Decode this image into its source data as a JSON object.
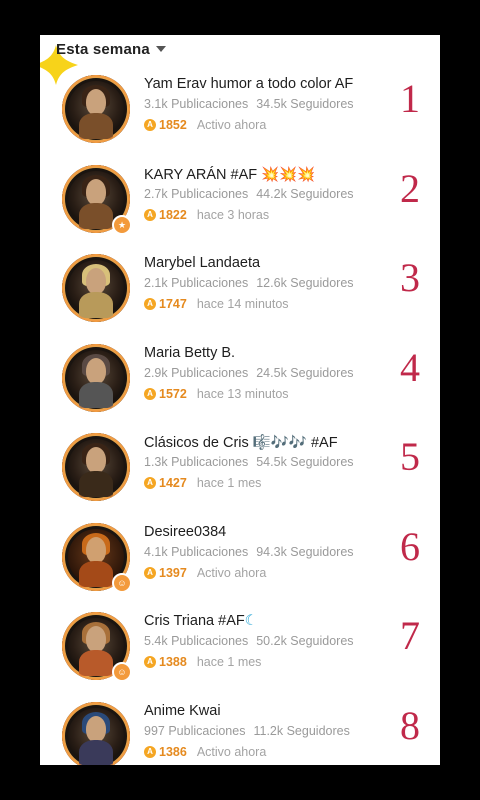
{
  "header": {
    "label": "Esta semana"
  },
  "items": [
    {
      "name": "Yam Erav humor a todo color AF",
      "publications": "3.1k Publicaciones",
      "followers": "34.5k Seguidores",
      "points": "1852",
      "status": "Activo ahora",
      "rank": "1"
    },
    {
      "name": "KARY ARÁN #AF",
      "name_suffix": "💥💥💥",
      "publications": "2.7k Publicaciones",
      "followers": "44.2k Seguidores",
      "points": "1822",
      "status": "hace 3 horas",
      "rank": "2"
    },
    {
      "name": "Marybel Landaeta",
      "publications": "2.1k Publicaciones",
      "followers": "12.6k Seguidores",
      "points": "1747",
      "status": "hace 14 minutos",
      "rank": "3"
    },
    {
      "name": "Maria Betty B.",
      "publications": "2.9k Publicaciones",
      "followers": "24.5k Seguidores",
      "points": "1572",
      "status": "hace 13 minutos",
      "rank": "4"
    },
    {
      "name": "Clásicos de Cris 🎼🎶🎶 #AF",
      "publications": "1.3k Publicaciones",
      "followers": "54.5k Seguidores",
      "points": "1427",
      "status": "hace 1 mes",
      "rank": "5"
    },
    {
      "name": "Desiree0384",
      "publications": "4.1k Publicaciones",
      "followers": "94.3k Seguidores",
      "points": "1397",
      "status": "Activo ahora",
      "rank": "6"
    },
    {
      "name": "Cris Triana #AF",
      "name_suffix": "☾",
      "publications": "5.4k Publicaciones",
      "followers": "50.2k Seguidores",
      "points": "1388",
      "status": "hace 1 mes",
      "rank": "7"
    },
    {
      "name": "Anime Kwai",
      "publications": "997 Publicaciones",
      "followers": "11.2k Seguidores",
      "points": "1386",
      "status": "Activo ahora",
      "rank": "8"
    }
  ],
  "colors": {
    "rank": "#c0294a",
    "points": "#e58a1f",
    "coin": "#f5a623"
  }
}
